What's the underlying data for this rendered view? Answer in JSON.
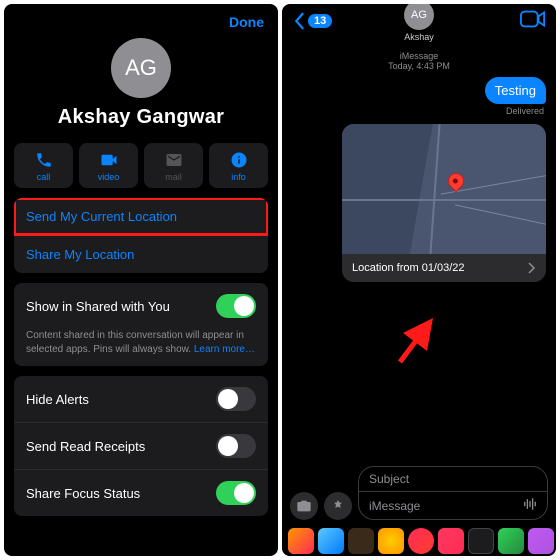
{
  "left": {
    "done": "Done",
    "initials": "AG",
    "name": "Akshay Gangwar",
    "actions": {
      "call": "call",
      "video": "video",
      "mail": "mail",
      "info": "info"
    },
    "send_current": "Send My Current Location",
    "share_loc": "Share My Location",
    "shared_with_you": "Show in Shared with You",
    "shared_desc": "Content shared in this conversation will appear in selected apps. Pins will always show. ",
    "learn_more": "Learn more…",
    "hide_alerts": "Hide Alerts",
    "read_receipts": "Send Read Receipts",
    "focus_status": "Share Focus Status"
  },
  "right": {
    "back_count": "13",
    "initials": "AG",
    "name": "Akshay",
    "ts_line1": "iMessage",
    "ts_line2": "Today, 4:43 PM",
    "bubble": "Testing",
    "delivered": "Delivered",
    "loc_label": "Location from 01/03/22",
    "subject_ph": "Subject",
    "imessage_ph": "iMessage"
  },
  "colors": {
    "accent": "#0a84ff",
    "green": "#30d158",
    "red": "#ff3b30"
  }
}
